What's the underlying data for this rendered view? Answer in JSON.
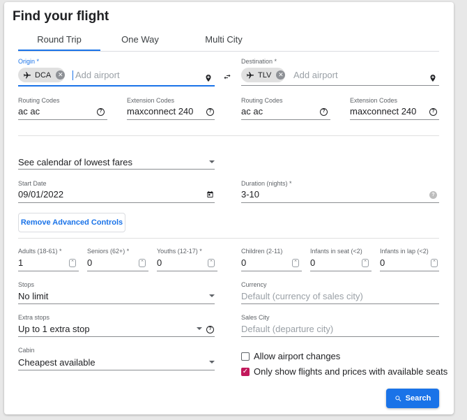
{
  "title": "Find your flight",
  "tabs": [
    "Round Trip",
    "One Way",
    "Multi City"
  ],
  "origin": {
    "label": "Origin *",
    "chip": "DCA",
    "placeholder": "Add airport"
  },
  "destination": {
    "label": "Destination *",
    "chip": "TLV",
    "placeholder": "Add airport"
  },
  "origin_codes": {
    "routing_label": "Routing Codes",
    "routing_value": "ac ac",
    "extension_label": "Extension Codes",
    "extension_value": "maxconnect 240"
  },
  "destination_codes": {
    "routing_label": "Routing Codes",
    "routing_value": "ac ac",
    "extension_label": "Extension Codes",
    "extension_value": "maxconnect 240"
  },
  "calendar_select": "See calendar of lowest fares",
  "start_date": {
    "label": "Start Date",
    "value": "09/01/2022"
  },
  "duration": {
    "label": "Duration (nights) *",
    "value": "3-10"
  },
  "advanced_button": "Remove Advanced Controls",
  "passengers": [
    {
      "label": "Adults (18-61) *",
      "value": "1"
    },
    {
      "label": "Seniors (62+) *",
      "value": "0"
    },
    {
      "label": "Youths (12-17) *",
      "value": "0"
    },
    {
      "label": "Children (2-11)",
      "value": "0"
    },
    {
      "label": "Infants in seat (<2)",
      "value": "0"
    },
    {
      "label": "Infants in lap (<2)",
      "value": "0"
    }
  ],
  "stops": {
    "label": "Stops",
    "value": "No limit"
  },
  "currency": {
    "label": "Currency",
    "placeholder": "Default (currency of sales city)"
  },
  "extra_stops": {
    "label": "Extra stops",
    "value": "Up to 1 extra stop"
  },
  "sales_city": {
    "label": "Sales City",
    "placeholder": "Default (departure city)"
  },
  "cabin": {
    "label": "Cabin",
    "value": "Cheapest available"
  },
  "allow_airport_changes": {
    "label": "Allow airport changes",
    "checked": false
  },
  "available_seats": {
    "label": "Only show flights and prices with available seats",
    "checked": true
  },
  "search_button": "Search",
  "colors": {
    "accent": "#1a73e8",
    "checkbox": "#c2185b"
  }
}
